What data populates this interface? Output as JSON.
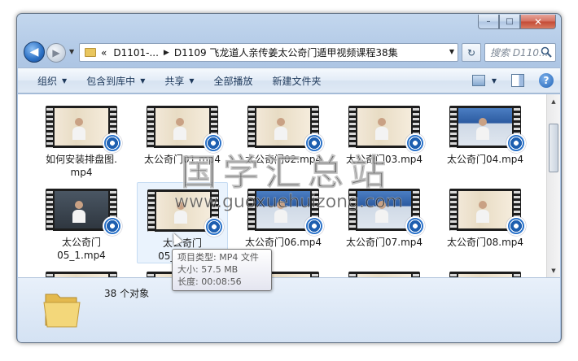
{
  "window": {
    "caption_min": "–",
    "caption_max": "□",
    "caption_close": "✕"
  },
  "nav": {
    "back_glyph": "◀",
    "forward_glyph": "▶",
    "history_glyph": "▼",
    "address": {
      "overflow": "«",
      "segment_1": "D1101-...",
      "separator": "▶",
      "segment_2": "D1109 飞龙道人亲传姜太公奇门遁甲视频课程38集",
      "dropdown": "▼"
    },
    "refresh_glyph": "↻",
    "search_placeholder": "搜索 D110..."
  },
  "toolbar": {
    "organize": "组织",
    "include_in_library": "包含到库中",
    "share": "共享",
    "play_all": "全部播放",
    "new_folder": "新建文件夹",
    "dropdown": "▼",
    "help": "?"
  },
  "files": [
    {
      "label": "如何安装排盘图.\nmp4",
      "style": "chart"
    },
    {
      "label": "太公奇门01.mp4",
      "style": "chart"
    },
    {
      "label": "太公奇门02.mp4",
      "style": "chart"
    },
    {
      "label": "太公奇门03.mp4",
      "style": "chart"
    },
    {
      "label": "太公奇门04.mp4",
      "style": "screen"
    },
    {
      "label": "太公奇门\n05_1.mp4",
      "style": "dark"
    },
    {
      "label": "太公奇门\n05_2.mp4",
      "style": "chart"
    },
    {
      "label": "太公奇门06.mp4",
      "style": "screen"
    },
    {
      "label": "太公奇门07.mp4",
      "style": "screen"
    },
    {
      "label": "太公奇门08.mp4",
      "style": "chart"
    }
  ],
  "tooltip": {
    "line1": "项目类型: MP4 文件",
    "line2": "大小: 57.5 MB",
    "line3": "长度: 00:08:56"
  },
  "scrollbar": {
    "up": "▲",
    "down": "▼"
  },
  "details": {
    "count_text": "38 个对象"
  },
  "watermark": {
    "main": "国学汇总站",
    "url": "www.guoxuehuizong.com"
  }
}
